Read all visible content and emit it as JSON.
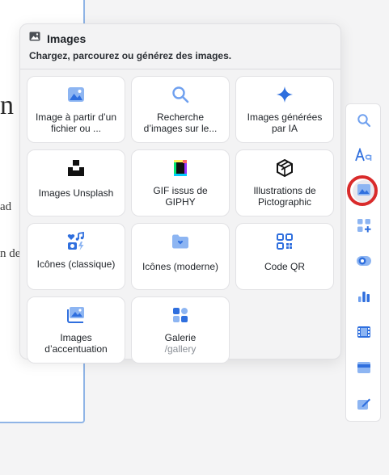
{
  "background": {
    "frag_heading": "n",
    "frag_line1": "ad",
    "frag_line2": "n de"
  },
  "popover": {
    "title": "Images",
    "subtitle": "Chargez, parcourez ou générez des images.",
    "tiles": [
      {
        "label": "Image à partir d’un fichier ou ...",
        "icon": "image-upload-icon"
      },
      {
        "label": "Recherche d’images sur le...",
        "icon": "search-icon"
      },
      {
        "label": "Images générées par IA",
        "icon": "sparkle-icon"
      },
      {
        "label": "Images Unsplash",
        "icon": "unsplash-icon"
      },
      {
        "label": "GIF issus de GIPHY",
        "icon": "giphy-icon"
      },
      {
        "label": "Illustrations de Pictographic",
        "icon": "pictographic-icon"
      },
      {
        "label": "Icônes (classique)",
        "icon": "classic-icons-icon"
      },
      {
        "label": "Icônes (moderne)",
        "icon": "modern-icons-icon"
      },
      {
        "label": "Code QR",
        "icon": "qr-code-icon"
      },
      {
        "label": "Images d’accentuation",
        "icon": "accent-images-icon"
      },
      {
        "label": "Galerie",
        "sublabel": "/gallery",
        "icon": "gallery-icon"
      }
    ]
  },
  "toolbar": {
    "items": [
      "search-icon",
      "text-icon",
      "image-icon",
      "add-block-icon",
      "toggle-icon",
      "chart-icon",
      "video-icon",
      "card-icon",
      "edit-form-icon"
    ],
    "active": "image-icon"
  },
  "colors": {
    "accent": "#2f6fde",
    "accent_light": "#6fa0ef",
    "highlight_ring": "#d92b2b"
  }
}
